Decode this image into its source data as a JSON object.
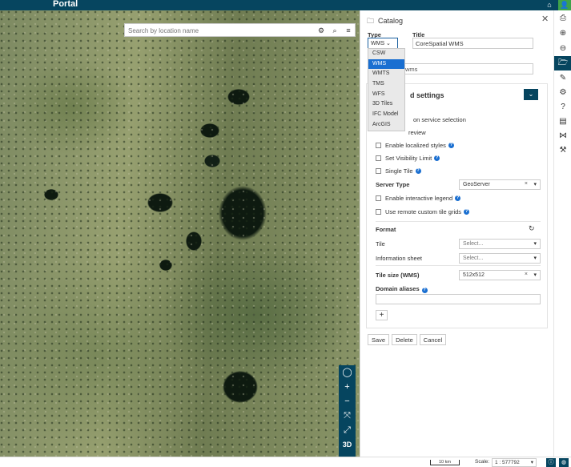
{
  "app": {
    "brand": "Portal"
  },
  "search": {
    "placeholder": "Search by location name"
  },
  "catalog": {
    "title": "Catalog",
    "type_label": "Type",
    "title_label": "Title",
    "type_value": "WMS",
    "title_value": "CoreSpatial WMS",
    "url_partial": "wms",
    "type_options": [
      "CSW",
      "WMS",
      "WMTS",
      "TMS",
      "WFS",
      "3D Tiles",
      "IFC Model",
      "ArcGIS"
    ],
    "selected_option": "WMS",
    "advanced": {
      "title": "d settings",
      "partial_option_1": "on service selection",
      "partial_option_2": "review",
      "checkboxes": [
        "Enable localized styles",
        "Set Visibility Limit",
        "Single Tile"
      ],
      "server_type_label": "Server Type",
      "server_type_value": "GeoServer",
      "checkboxes2": [
        "Enable interactive legend",
        "Use remote custom tile grids"
      ],
      "format_label": "Format",
      "tile_label": "Tile",
      "tile_placeholder": "Select...",
      "info_label": "Information sheet",
      "info_placeholder": "Select...",
      "tile_size_label": "Tile size (WMS)",
      "tile_size_value": "512x512",
      "domain_aliases_label": "Domain aliases"
    },
    "buttons": {
      "save": "Save",
      "delete": "Delete",
      "cancel": "Cancel"
    }
  },
  "map_controls": {
    "three_d": "3D"
  },
  "status": {
    "scale_bar": "10 km",
    "scale_label": "Scale:",
    "scale_value": "1 : 577792"
  },
  "colors": {
    "primary": "#06455f",
    "selected": "#1a6fd1",
    "user": "#3fa24a"
  }
}
